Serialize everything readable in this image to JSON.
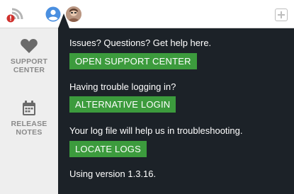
{
  "topbar": {
    "connection_icon": "wifi-warning-icon",
    "user_icon": "person-icon",
    "add_icon": "plus-square-icon"
  },
  "sidebar": {
    "items": [
      {
        "label_line1": "SUPPORT",
        "label_line2": "CENTER",
        "icon": "heart-icon"
      },
      {
        "label_line1": "RELEASE",
        "label_line2": "NOTES",
        "icon": "calendar-icon"
      }
    ]
  },
  "panel": {
    "help_text": "Issues? Questions? Get help here.",
    "support_button": "OPEN SUPPORT CENTER",
    "login_text": "Having trouble logging in?",
    "login_button": "ALTERNATIVE LOGIN",
    "logs_text": "Your log file will help us in troubleshooting.",
    "logs_button": "LOCATE LOGS",
    "version_text": "Using version 1.3.16."
  },
  "colors": {
    "panel_bg": "#1c2228",
    "button_green": "#3c9b3d",
    "sidebar_bg": "#eeeeee",
    "alert_red": "#d0312d"
  }
}
